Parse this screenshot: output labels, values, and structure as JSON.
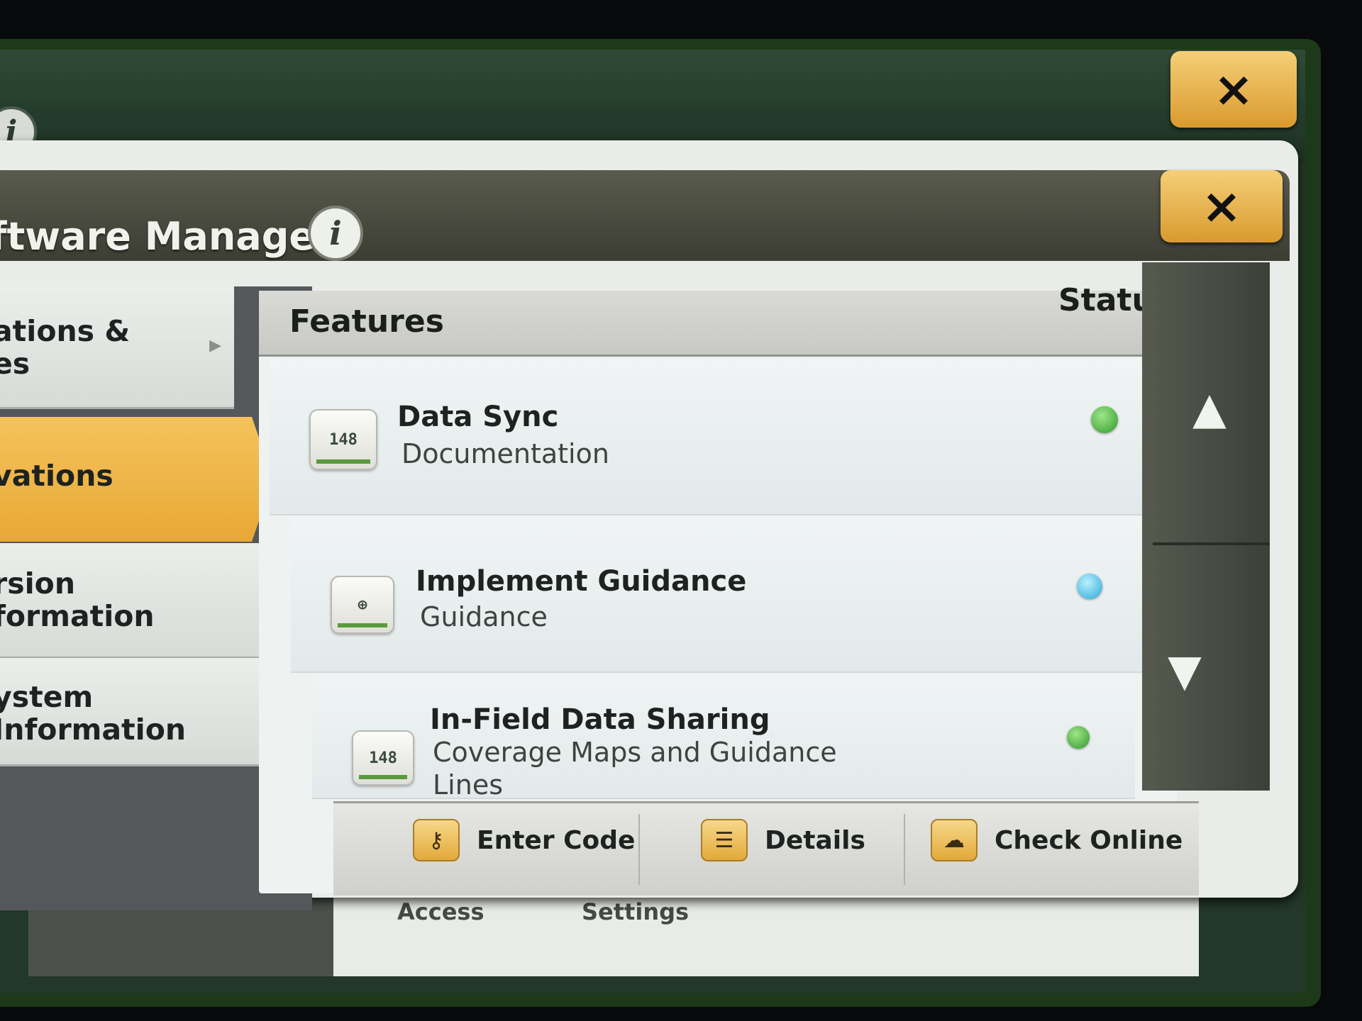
{
  "outer_window": {
    "info_icon": "info-icon",
    "close_label": "×"
  },
  "modal": {
    "title": "ftware Manager",
    "info_icon": "info-icon",
    "close_label": "×"
  },
  "sidebar": {
    "items": [
      {
        "label": "ations &\nes",
        "active": false
      },
      {
        "label": "vations",
        "active": true
      },
      {
        "label": "rsion\nformation",
        "active": false
      },
      {
        "label": "ystem\nInformation",
        "active": false
      }
    ]
  },
  "table": {
    "features_header": "Features",
    "status_header": "Status",
    "rows": [
      {
        "name": "Data Sync",
        "subtitle": "Documentation",
        "icon": "148",
        "status_color": "green"
      },
      {
        "name": "Implement Guidance",
        "subtitle": "Guidance",
        "icon": "guidance-icon",
        "status_color": "blue"
      },
      {
        "name": "In-Field Data Sharing",
        "subtitle": "Coverage Maps and Guidance\nLines",
        "icon": "148",
        "status_color": "green"
      }
    ]
  },
  "toolbar": {
    "enter_code": "Enter Code",
    "details": "Details",
    "check_online": "Check Online"
  },
  "background_tabs": {
    "access": "Access",
    "settings": "Settings"
  },
  "colors": {
    "accent": "#e8a836",
    "status_green": "#2f9a2a",
    "status_blue": "#2aa8d8"
  }
}
